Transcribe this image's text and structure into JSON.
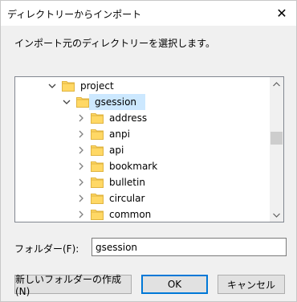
{
  "window": {
    "title": "ディレクトリーからインポート",
    "close_glyph": "✕"
  },
  "instruction": "インポート元のディレクトリーを選択します。",
  "tree": {
    "items": [
      {
        "label": "project",
        "level": 1,
        "expanded": true,
        "selected": false
      },
      {
        "label": "gsession",
        "level": 2,
        "expanded": true,
        "selected": true
      },
      {
        "label": "address",
        "level": 3,
        "expanded": false,
        "selected": false
      },
      {
        "label": "anpi",
        "level": 3,
        "expanded": false,
        "selected": false
      },
      {
        "label": "api",
        "level": 3,
        "expanded": false,
        "selected": false
      },
      {
        "label": "bookmark",
        "level": 3,
        "expanded": false,
        "selected": false
      },
      {
        "label": "bulletin",
        "level": 3,
        "expanded": false,
        "selected": false
      },
      {
        "label": "circular",
        "level": 3,
        "expanded": false,
        "selected": false
      },
      {
        "label": "common",
        "level": 3,
        "expanded": false,
        "selected": false
      }
    ],
    "icon_expanded": "chevron-down-icon",
    "icon_collapsed": "chevron-right-icon",
    "folder_icon": "folder-icon"
  },
  "folder_field": {
    "label": "フォルダー(F):",
    "value": "gsession"
  },
  "buttons": {
    "new_folder": "新しいフォルダーの作成(N)",
    "ok": "OK",
    "cancel": "キャンセル"
  },
  "colors": {
    "selection": "#cce8ff",
    "folder": "#ffd865",
    "default_button_border": "#0078d7"
  }
}
